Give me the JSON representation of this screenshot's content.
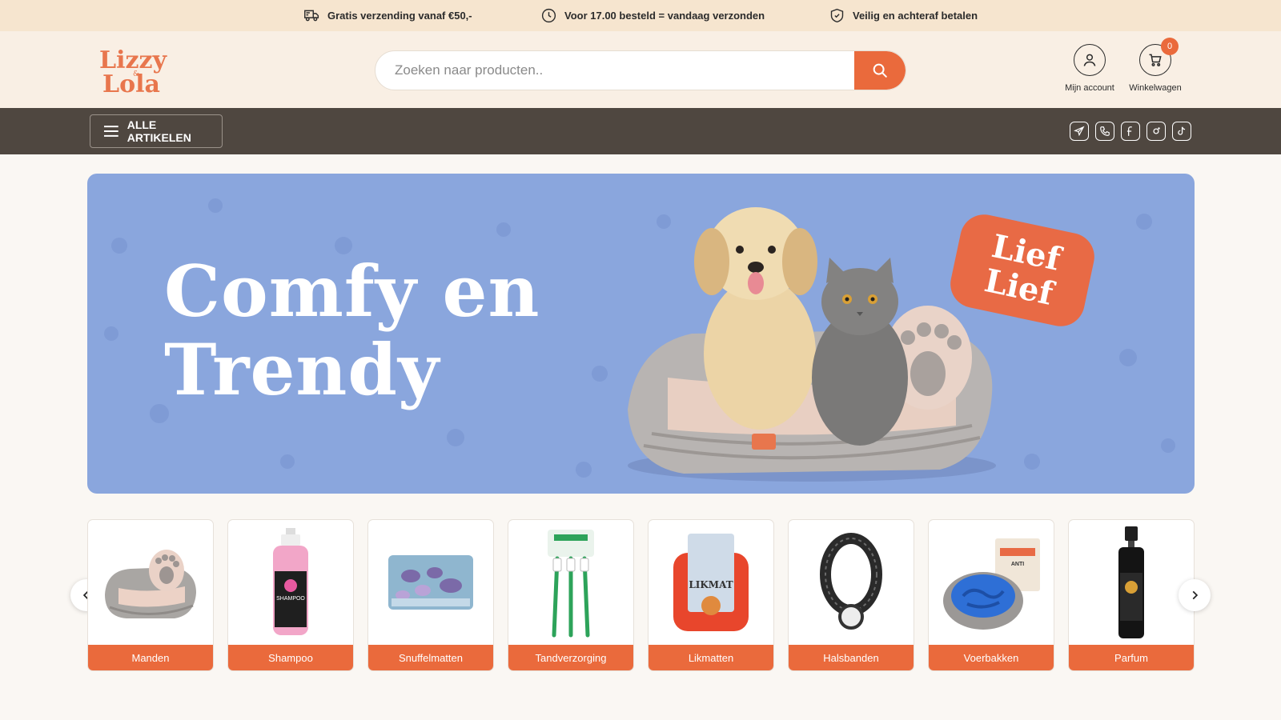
{
  "usp": [
    {
      "icon": "truck-icon",
      "text": "Gratis verzending vanaf €50,-"
    },
    {
      "icon": "clock-icon",
      "text": "Voor 17.00 besteld = vandaag verzonden"
    },
    {
      "icon": "shield-icon",
      "text": "Veilig en achteraf betalen"
    }
  ],
  "header": {
    "logo_text": "Lizzy & Lola",
    "search_placeholder": "Zoeken naar producten..",
    "account_label": "Mijn account",
    "cart_label": "Winkelwagen",
    "cart_count": "0"
  },
  "nav": {
    "all_articles": "ALLE ARTIKELEN",
    "social": [
      "telegram-icon",
      "phone-icon",
      "facebook-icon",
      "instagram-icon",
      "tiktok-icon"
    ]
  },
  "hero": {
    "title_line1": "Comfy en",
    "title_line2": "Trendy",
    "sticker_line1": "Lief",
    "sticker_line2": "Lief"
  },
  "categories": [
    {
      "label": "Manden",
      "icon": "dog-bed-icon"
    },
    {
      "label": "Shampoo",
      "icon": "shampoo-bottle-icon"
    },
    {
      "label": "Snuffelmatten",
      "icon": "snuffle-mat-icon"
    },
    {
      "label": "Tandverzorging",
      "icon": "toothbrush-icon"
    },
    {
      "label": "Likmatten",
      "icon": "lick-mat-icon"
    },
    {
      "label": "Halsbanden",
      "icon": "collar-icon"
    },
    {
      "label": "Voerbakken",
      "icon": "food-bowl-icon"
    },
    {
      "label": "Parfum",
      "icon": "perfume-bottle-icon"
    }
  ],
  "colors": {
    "accent": "#ea6a3c",
    "nav_bg": "#4f4740",
    "hero_bg": "#8aa6dd",
    "usp_bg": "#f6e5cf"
  }
}
